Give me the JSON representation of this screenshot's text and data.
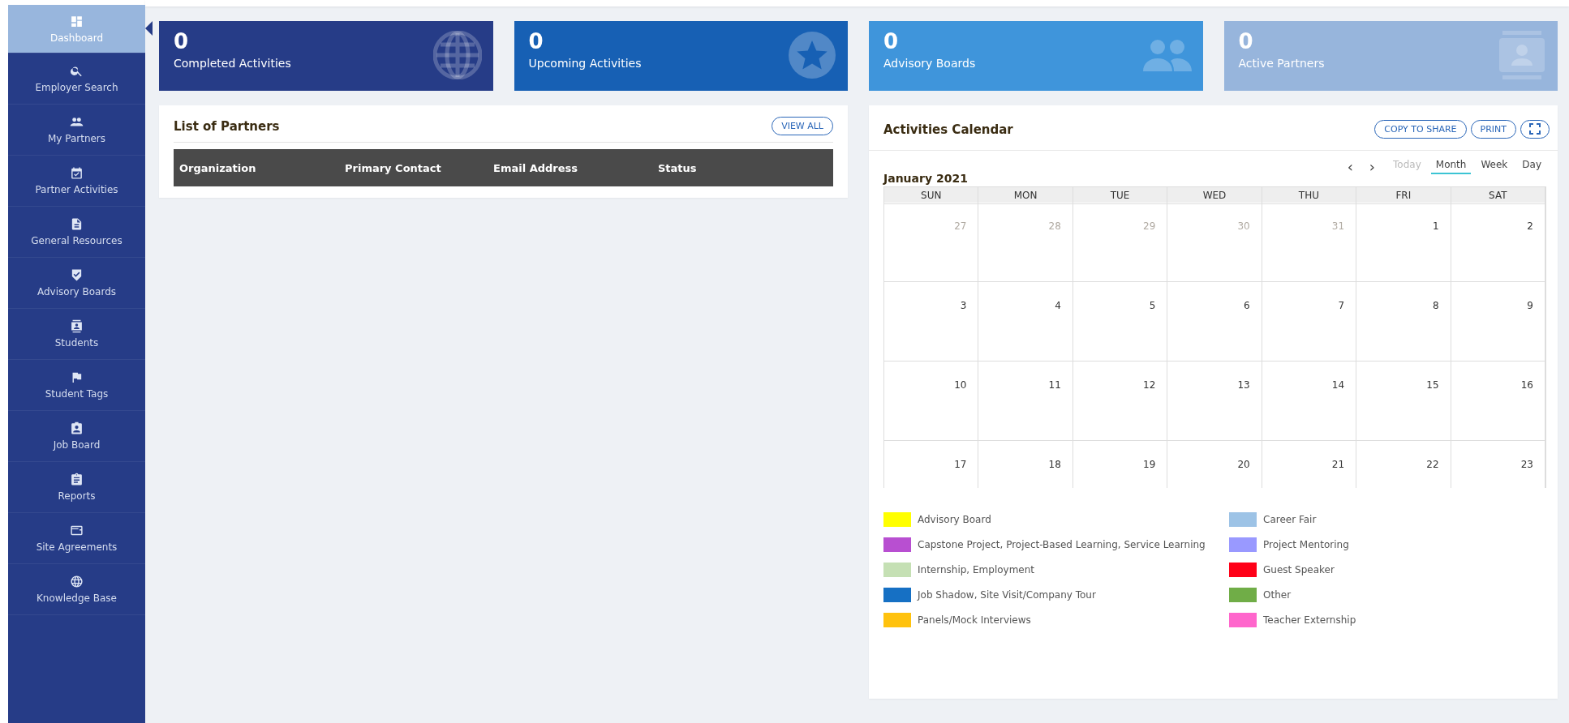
{
  "sidebar": {
    "items": [
      {
        "label": "Dashboard",
        "selected": true
      },
      {
        "label": "Employer Search",
        "selected": false
      },
      {
        "label": "My Partners",
        "selected": false
      },
      {
        "label": "Partner Activities",
        "selected": false
      },
      {
        "label": "General Resources",
        "selected": false
      },
      {
        "label": "Advisory Boards",
        "selected": false
      },
      {
        "label": "Students",
        "selected": false
      },
      {
        "label": "Student Tags",
        "selected": false
      },
      {
        "label": "Job Board",
        "selected": false
      },
      {
        "label": "Reports",
        "selected": false
      },
      {
        "label": "Site Agreements",
        "selected": false
      },
      {
        "label": "Knowledge Base",
        "selected": false
      }
    ]
  },
  "stat_cards": [
    {
      "value": "0",
      "label": "Completed Activities"
    },
    {
      "value": "0",
      "label": "Upcoming Activities"
    },
    {
      "value": "0",
      "label": "Advisory Boards"
    },
    {
      "value": "0",
      "label": "Active Partners"
    }
  ],
  "partners_panel": {
    "title": "List of Partners",
    "button": "VIEW ALL",
    "table": {
      "columns": [
        "Organization",
        "Primary Contact",
        "Email Address",
        "Status"
      ]
    }
  },
  "calendar_panel": {
    "title": "Activities Calendar",
    "buttons": [
      "COPY TO SHARE",
      "PRINT"
    ],
    "nav": {
      "prev": "‹",
      "next": "›"
    },
    "views": [
      {
        "label": "Today",
        "disabled": true,
        "selected": false
      },
      {
        "label": "Month",
        "disabled": false,
        "selected": true
      },
      {
        "label": "Week",
        "disabled": false,
        "selected": false
      },
      {
        "label": "Day",
        "disabled": false,
        "selected": false
      }
    ],
    "month_title": "January 2021",
    "weekdays": [
      "SUN",
      "MON",
      "TUE",
      "WED",
      "THU",
      "FRI",
      "SAT"
    ],
    "weeks": [
      [
        {
          "day": "27",
          "other_month": true
        },
        {
          "day": "28",
          "other_month": true
        },
        {
          "day": "29",
          "other_month": true
        },
        {
          "day": "30",
          "other_month": true
        },
        {
          "day": "31",
          "other_month": true
        },
        {
          "day": "1",
          "other_month": false
        },
        {
          "day": "2",
          "other_month": false
        }
      ],
      [
        {
          "day": "3",
          "other_month": false
        },
        {
          "day": "4",
          "other_month": false
        },
        {
          "day": "5",
          "other_month": false
        },
        {
          "day": "6",
          "other_month": false
        },
        {
          "day": "7",
          "other_month": false
        },
        {
          "day": "8",
          "other_month": false
        },
        {
          "day": "9",
          "other_month": false
        }
      ],
      [
        {
          "day": "10",
          "other_month": false
        },
        {
          "day": "11",
          "other_month": false
        },
        {
          "day": "12",
          "other_month": false
        },
        {
          "day": "13",
          "other_month": false
        },
        {
          "day": "14",
          "other_month": false
        },
        {
          "day": "15",
          "other_month": false
        },
        {
          "day": "16",
          "other_month": false
        }
      ],
      [
        {
          "day": "17",
          "other_month": false
        },
        {
          "day": "18",
          "other_month": false
        },
        {
          "day": "19",
          "other_month": false
        },
        {
          "day": "20",
          "other_month": false
        },
        {
          "day": "21",
          "other_month": false
        },
        {
          "day": "22",
          "other_month": false
        },
        {
          "day": "23",
          "other_month": false
        }
      ]
    ],
    "legend": [
      {
        "label": "Advisory Board",
        "color": "#ffff00"
      },
      {
        "label": "Career Fair",
        "color": "#9dc3e6"
      },
      {
        "label": "Capstone Project, Project-Based Learning, Service Learning",
        "color": "#b84fd1"
      },
      {
        "label": "Project Mentoring",
        "color": "#9999ff"
      },
      {
        "label": "Internship, Employment",
        "color": "#c5e0b4"
      },
      {
        "label": "Guest Speaker",
        "color": "#ff0018"
      },
      {
        "label": "Job Shadow, Site Visit/Company Tour",
        "color": "#1670c4"
      },
      {
        "label": "Other",
        "color": "#70ad47"
      },
      {
        "label": "Panels/Mock Interviews",
        "color": "#ffc20e"
      },
      {
        "label": "Teacher Externship",
        "color": "#ff66cc"
      }
    ]
  }
}
